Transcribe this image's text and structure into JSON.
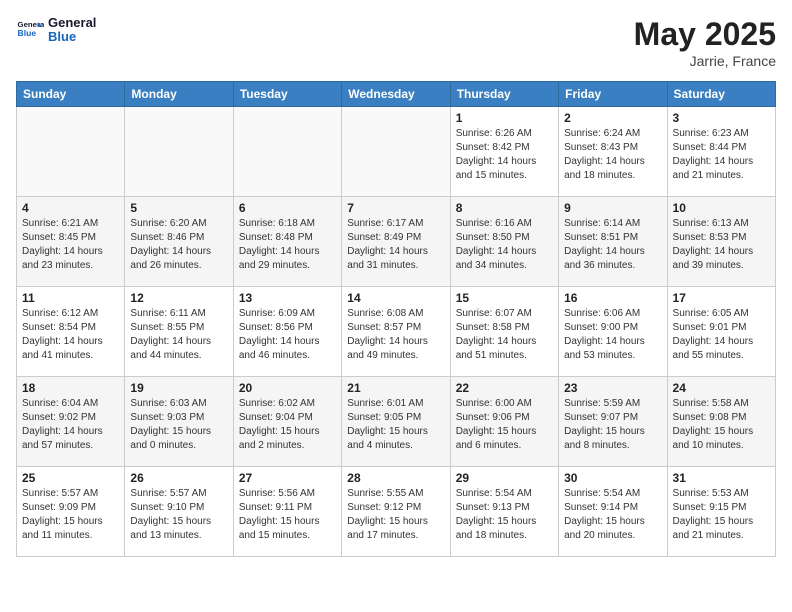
{
  "header": {
    "logo_general": "General",
    "logo_blue": "Blue",
    "month": "May 2025",
    "location": "Jarrie, France"
  },
  "weekdays": [
    "Sunday",
    "Monday",
    "Tuesday",
    "Wednesday",
    "Thursday",
    "Friday",
    "Saturday"
  ],
  "weeks": [
    [
      {
        "day": "",
        "info": ""
      },
      {
        "day": "",
        "info": ""
      },
      {
        "day": "",
        "info": ""
      },
      {
        "day": "",
        "info": ""
      },
      {
        "day": "1",
        "info": "Sunrise: 6:26 AM\nSunset: 8:42 PM\nDaylight: 14 hours\nand 15 minutes."
      },
      {
        "day": "2",
        "info": "Sunrise: 6:24 AM\nSunset: 8:43 PM\nDaylight: 14 hours\nand 18 minutes."
      },
      {
        "day": "3",
        "info": "Sunrise: 6:23 AM\nSunset: 8:44 PM\nDaylight: 14 hours\nand 21 minutes."
      }
    ],
    [
      {
        "day": "4",
        "info": "Sunrise: 6:21 AM\nSunset: 8:45 PM\nDaylight: 14 hours\nand 23 minutes."
      },
      {
        "day": "5",
        "info": "Sunrise: 6:20 AM\nSunset: 8:46 PM\nDaylight: 14 hours\nand 26 minutes."
      },
      {
        "day": "6",
        "info": "Sunrise: 6:18 AM\nSunset: 8:48 PM\nDaylight: 14 hours\nand 29 minutes."
      },
      {
        "day": "7",
        "info": "Sunrise: 6:17 AM\nSunset: 8:49 PM\nDaylight: 14 hours\nand 31 minutes."
      },
      {
        "day": "8",
        "info": "Sunrise: 6:16 AM\nSunset: 8:50 PM\nDaylight: 14 hours\nand 34 minutes."
      },
      {
        "day": "9",
        "info": "Sunrise: 6:14 AM\nSunset: 8:51 PM\nDaylight: 14 hours\nand 36 minutes."
      },
      {
        "day": "10",
        "info": "Sunrise: 6:13 AM\nSunset: 8:53 PM\nDaylight: 14 hours\nand 39 minutes."
      }
    ],
    [
      {
        "day": "11",
        "info": "Sunrise: 6:12 AM\nSunset: 8:54 PM\nDaylight: 14 hours\nand 41 minutes."
      },
      {
        "day": "12",
        "info": "Sunrise: 6:11 AM\nSunset: 8:55 PM\nDaylight: 14 hours\nand 44 minutes."
      },
      {
        "day": "13",
        "info": "Sunrise: 6:09 AM\nSunset: 8:56 PM\nDaylight: 14 hours\nand 46 minutes."
      },
      {
        "day": "14",
        "info": "Sunrise: 6:08 AM\nSunset: 8:57 PM\nDaylight: 14 hours\nand 49 minutes."
      },
      {
        "day": "15",
        "info": "Sunrise: 6:07 AM\nSunset: 8:58 PM\nDaylight: 14 hours\nand 51 minutes."
      },
      {
        "day": "16",
        "info": "Sunrise: 6:06 AM\nSunset: 9:00 PM\nDaylight: 14 hours\nand 53 minutes."
      },
      {
        "day": "17",
        "info": "Sunrise: 6:05 AM\nSunset: 9:01 PM\nDaylight: 14 hours\nand 55 minutes."
      }
    ],
    [
      {
        "day": "18",
        "info": "Sunrise: 6:04 AM\nSunset: 9:02 PM\nDaylight: 14 hours\nand 57 minutes."
      },
      {
        "day": "19",
        "info": "Sunrise: 6:03 AM\nSunset: 9:03 PM\nDaylight: 15 hours\nand 0 minutes."
      },
      {
        "day": "20",
        "info": "Sunrise: 6:02 AM\nSunset: 9:04 PM\nDaylight: 15 hours\nand 2 minutes."
      },
      {
        "day": "21",
        "info": "Sunrise: 6:01 AM\nSunset: 9:05 PM\nDaylight: 15 hours\nand 4 minutes."
      },
      {
        "day": "22",
        "info": "Sunrise: 6:00 AM\nSunset: 9:06 PM\nDaylight: 15 hours\nand 6 minutes."
      },
      {
        "day": "23",
        "info": "Sunrise: 5:59 AM\nSunset: 9:07 PM\nDaylight: 15 hours\nand 8 minutes."
      },
      {
        "day": "24",
        "info": "Sunrise: 5:58 AM\nSunset: 9:08 PM\nDaylight: 15 hours\nand 10 minutes."
      }
    ],
    [
      {
        "day": "25",
        "info": "Sunrise: 5:57 AM\nSunset: 9:09 PM\nDaylight: 15 hours\nand 11 minutes."
      },
      {
        "day": "26",
        "info": "Sunrise: 5:57 AM\nSunset: 9:10 PM\nDaylight: 15 hours\nand 13 minutes."
      },
      {
        "day": "27",
        "info": "Sunrise: 5:56 AM\nSunset: 9:11 PM\nDaylight: 15 hours\nand 15 minutes."
      },
      {
        "day": "28",
        "info": "Sunrise: 5:55 AM\nSunset: 9:12 PM\nDaylight: 15 hours\nand 17 minutes."
      },
      {
        "day": "29",
        "info": "Sunrise: 5:54 AM\nSunset: 9:13 PM\nDaylight: 15 hours\nand 18 minutes."
      },
      {
        "day": "30",
        "info": "Sunrise: 5:54 AM\nSunset: 9:14 PM\nDaylight: 15 hours\nand 20 minutes."
      },
      {
        "day": "31",
        "info": "Sunrise: 5:53 AM\nSunset: 9:15 PM\nDaylight: 15 hours\nand 21 minutes."
      }
    ]
  ]
}
